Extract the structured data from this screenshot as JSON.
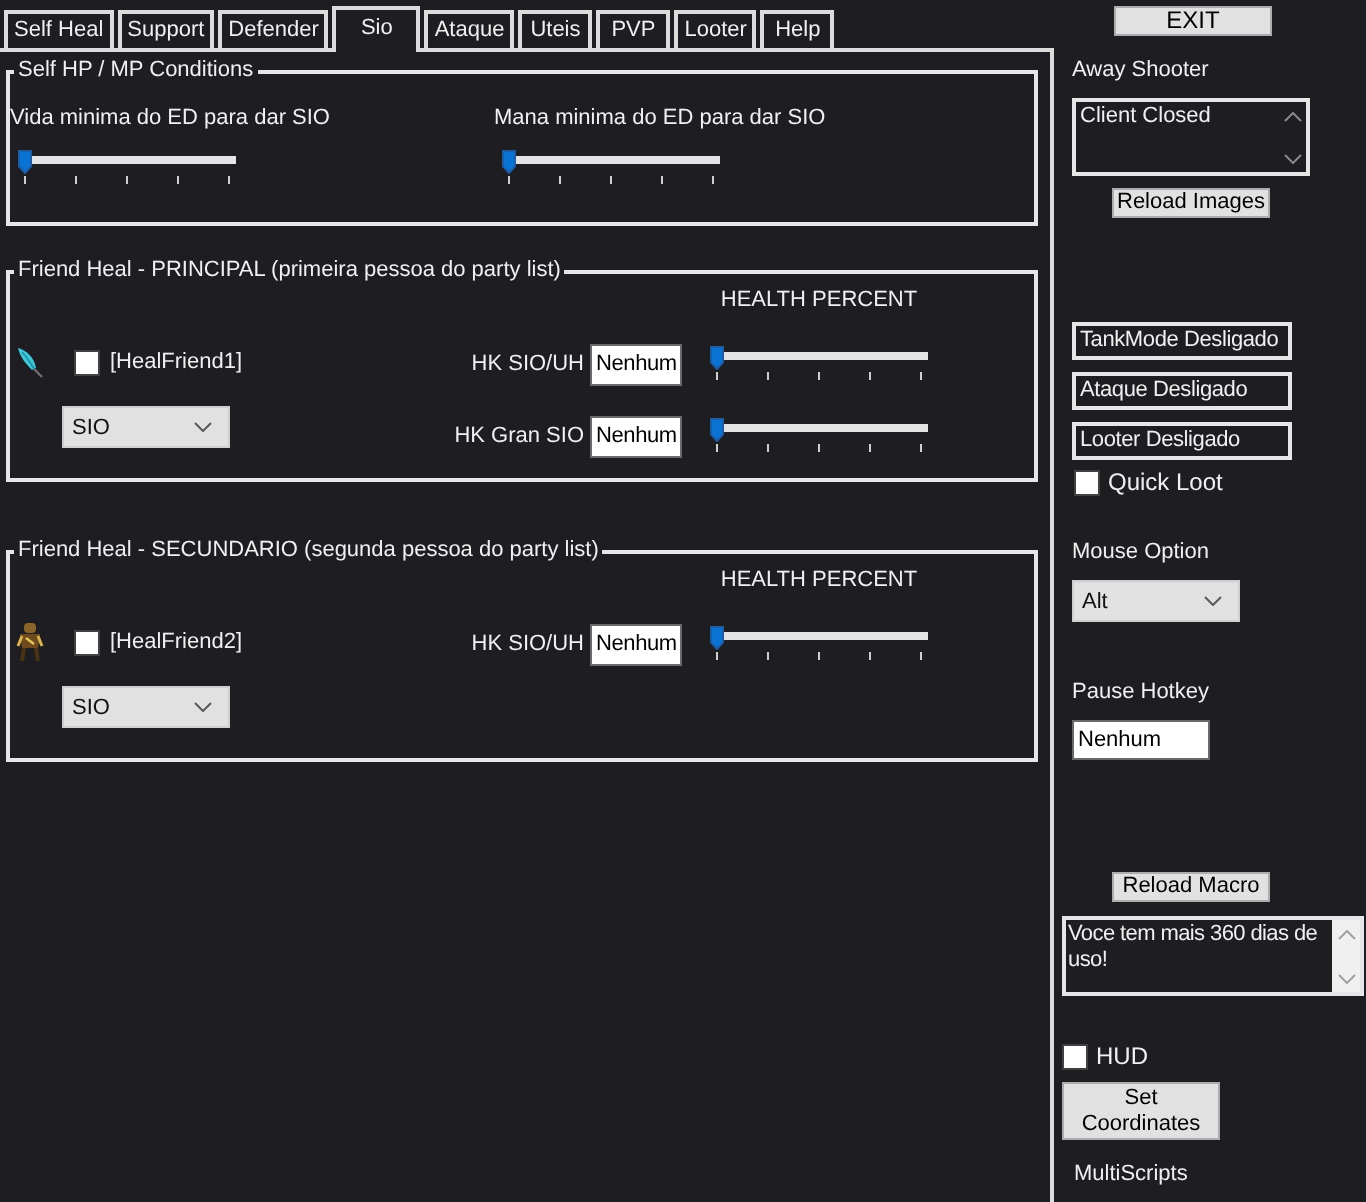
{
  "tabs": [
    {
      "label": "Self Heal",
      "selected": false
    },
    {
      "label": "Support",
      "selected": false
    },
    {
      "label": "Defender",
      "selected": false
    },
    {
      "label": "Sio",
      "selected": true
    },
    {
      "label": "Ataque",
      "selected": false
    },
    {
      "label": "Uteis",
      "selected": false
    },
    {
      "label": "PVP",
      "selected": false
    },
    {
      "label": "Looter",
      "selected": false
    },
    {
      "label": "Help",
      "selected": false
    }
  ],
  "self_conditions": {
    "title": "Self HP / MP Conditions",
    "sliders": [
      {
        "label": "Vida minima do ED para dar SIO",
        "level": 0
      },
      {
        "label": "Mana minima do ED para dar SIO",
        "level": 0
      }
    ]
  },
  "friend_groups": [
    {
      "title": "Friend Heal - PRINCIPAL (primeira pessoa do party list)",
      "health_header": "HEALTH PERCENT",
      "friend": {
        "label": "[HealFriend1]",
        "checked": false
      },
      "spell": "SIO",
      "hotkeys": [
        {
          "label": "HK SIO/UH",
          "value": "Nenhum",
          "level": 0
        },
        {
          "label": "HK Gran SIO",
          "value": "Nenhum",
          "level": 0
        }
      ]
    },
    {
      "title": "Friend Heal - SECUNDARIO (segunda pessoa do party list)",
      "health_header": "HEALTH PERCENT",
      "friend": {
        "label": "[HealFriend2]",
        "checked": false
      },
      "spell": "SIO",
      "hotkeys": [
        {
          "label": "HK SIO/UH",
          "value": "Nenhum",
          "level": 0
        }
      ]
    }
  ],
  "sidebar": {
    "exit_button": "EXIT",
    "away_shooter": {
      "label": "Away Shooter",
      "log": "Client Closed"
    },
    "reload_images_button": "Reload Images",
    "status_indicators": [
      "TankMode Desligado",
      "Ataque Desligado",
      "Looter Desligado"
    ],
    "quick_loot": {
      "label": "Quick Loot",
      "checked": false
    },
    "mouse_option": {
      "label": "Mouse Option",
      "value": "Alt"
    },
    "pause_hotkey": {
      "label": "Pause Hotkey",
      "value": "Nenhum"
    },
    "reload_macro_button": "Reload Macro",
    "message": "Voce tem mais 360 dias de uso!",
    "hud": {
      "label": "HUD",
      "checked": false
    },
    "set_coordinates_button": "Set Coordinates",
    "footer": "MultiScripts"
  }
}
